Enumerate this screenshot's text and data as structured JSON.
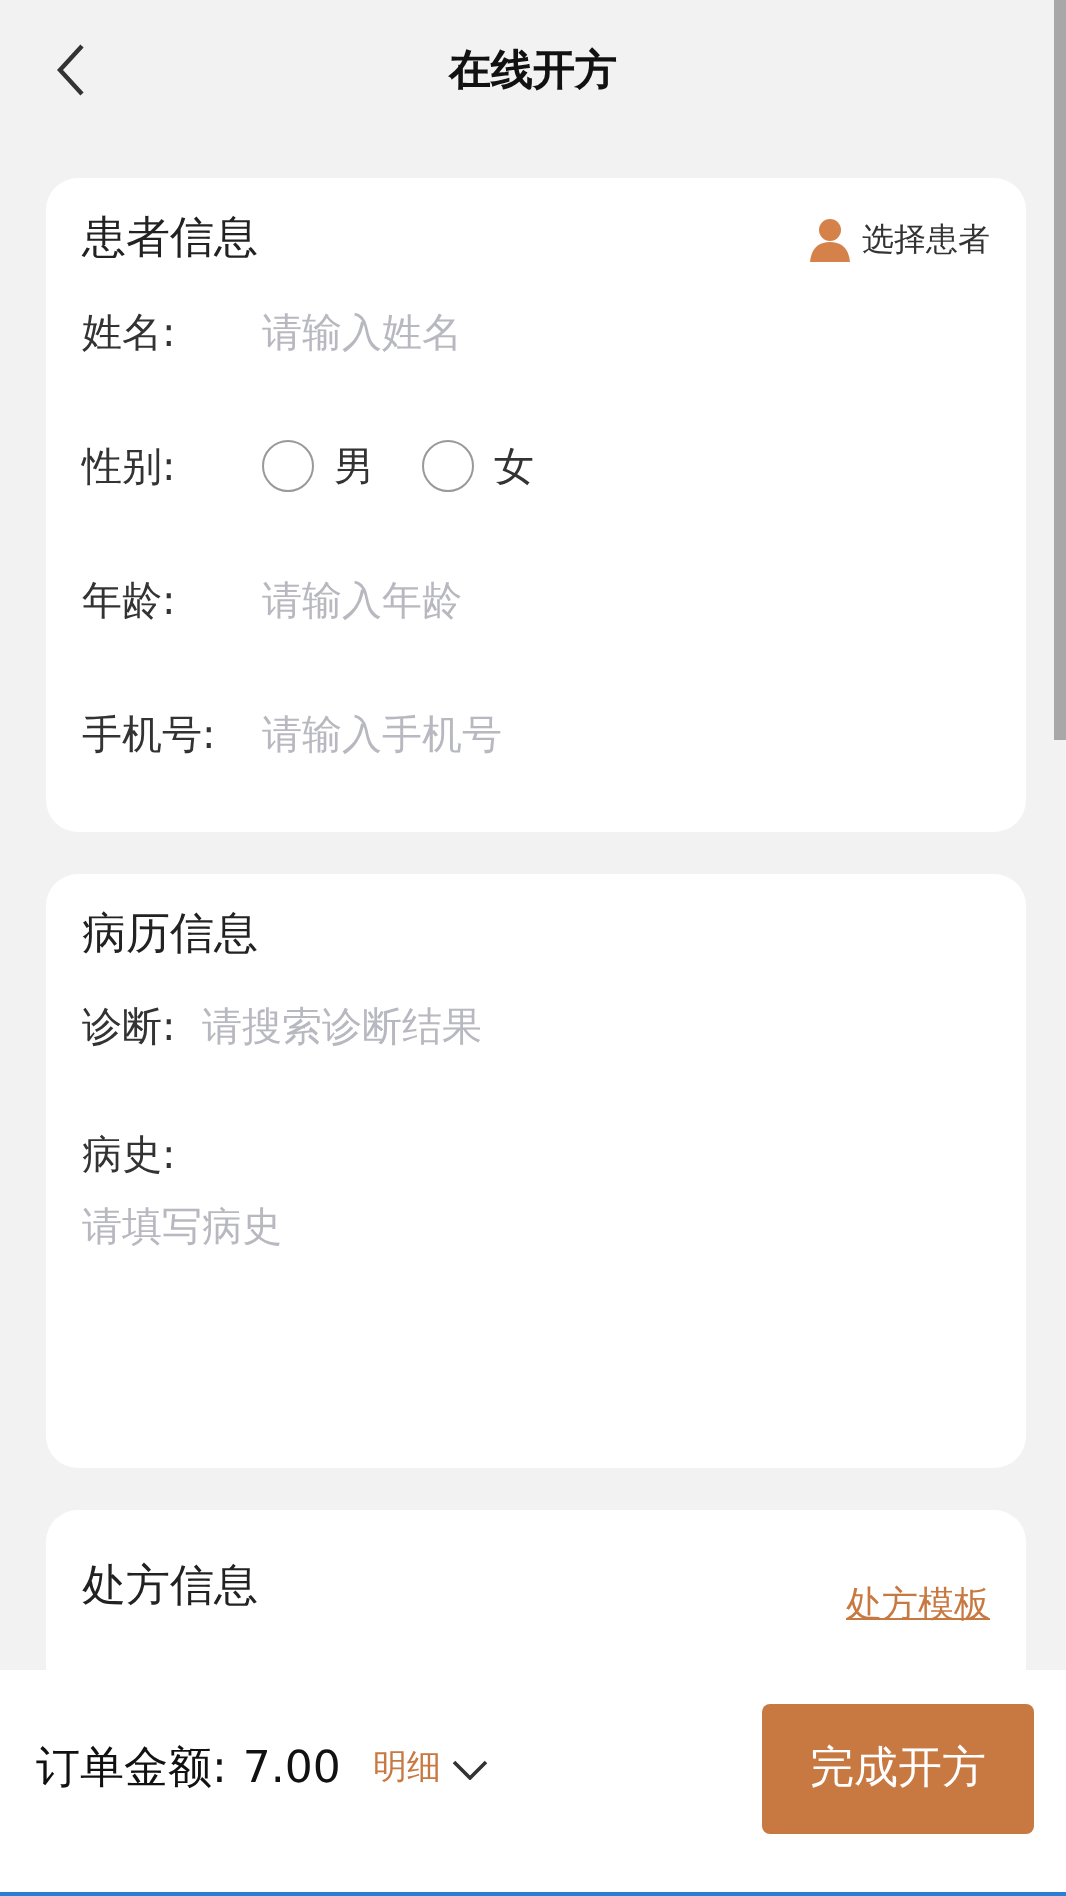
{
  "header": {
    "title": "在线开方"
  },
  "patient": {
    "title": "患者信息",
    "select_action": "选择患者",
    "fields": [
      {
        "kind": "input",
        "label": "姓名:",
        "placeholder": "请输入姓名"
      },
      {
        "kind": "radio",
        "label": "性别:",
        "options": [
          {
            "label": "男",
            "selected": false
          },
          {
            "label": "女",
            "selected": false
          }
        ]
      },
      {
        "kind": "input",
        "label": "年龄:",
        "placeholder": "请输入年龄"
      },
      {
        "kind": "input",
        "label": "手机号:",
        "placeholder": "请输入手机号"
      }
    ]
  },
  "record": {
    "title": "病历信息",
    "diagnosis": {
      "label": "诊断:",
      "placeholder": "请搜索诊断结果"
    },
    "history": {
      "label": "病史:",
      "placeholder": "请填写病史"
    }
  },
  "prescription": {
    "title": "处方信息",
    "template_link": "处方模板"
  },
  "footer": {
    "amount_label": "订单金额:",
    "amount": "7.00",
    "detail": "明细",
    "submit": "完成开方"
  }
}
